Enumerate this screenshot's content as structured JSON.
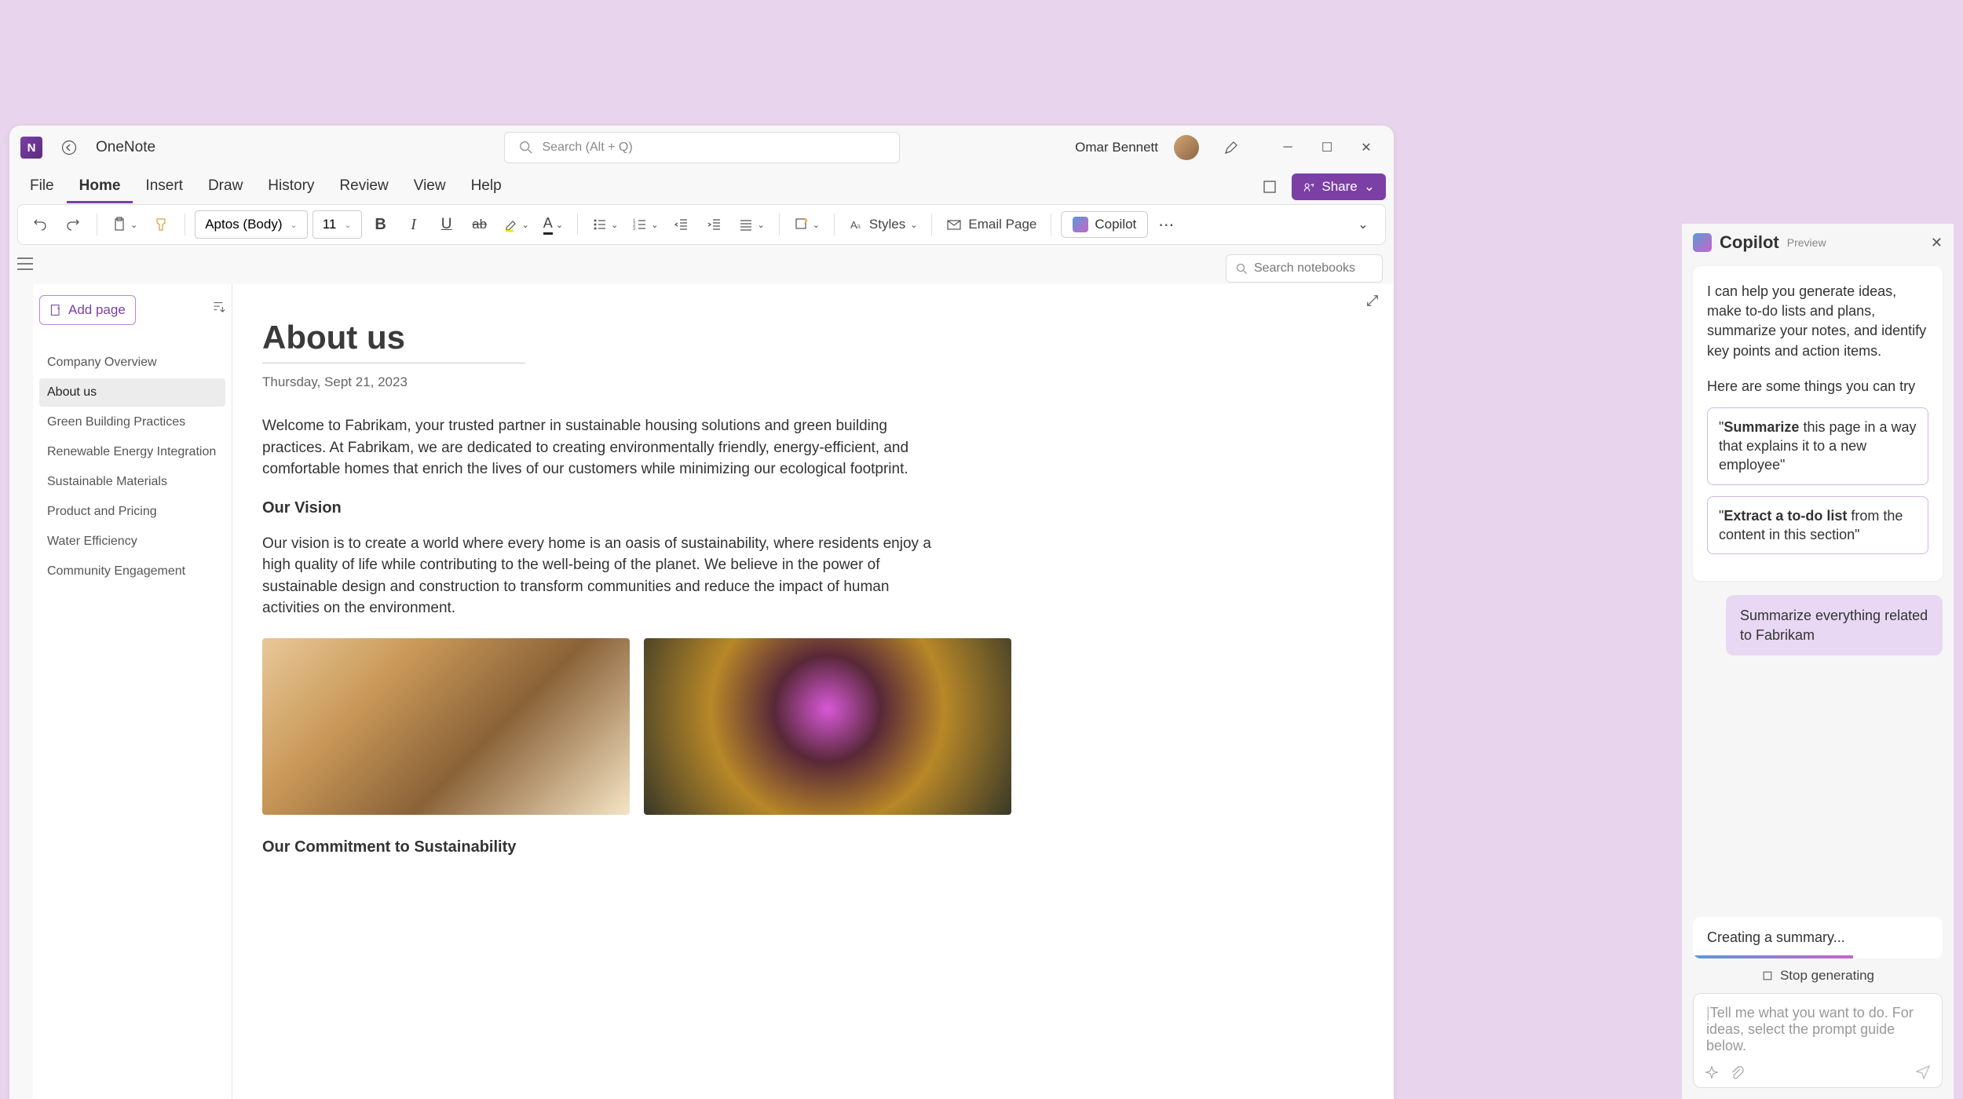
{
  "titlebar": {
    "app_name": "OneNote",
    "search_placeholder": "Search (Alt + Q)",
    "user_name": "Omar Bennett"
  },
  "menu": {
    "items": [
      "File",
      "Home",
      "Insert",
      "Draw",
      "History",
      "Review",
      "View",
      "Help"
    ],
    "active": "Home",
    "share": "Share"
  },
  "ribbon": {
    "font": "Aptos (Body)",
    "size": "11",
    "styles": "Styles",
    "email": "Email Page",
    "copilot": "Copilot"
  },
  "subbar": {
    "search_notebooks": "Search notebooks"
  },
  "sidebar": {
    "add_page": "Add page",
    "pages": [
      "Company Overview",
      "About us",
      "Green Building Practices",
      "Renewable Energy Integration",
      "Sustainable Materials",
      "Product and Pricing",
      "Water Efficiency",
      "Community Engagement"
    ],
    "active_index": 1
  },
  "note": {
    "title": "About us",
    "date": "Thursday, Sept 21, 2023",
    "p1": "Welcome to Fabrikam, your trusted partner in sustainable housing solutions and green building practices. At Fabrikam, we are dedicated to creating environmentally friendly, energy-efficient, and comfortable homes that enrich the lives of our customers while minimizing our ecological footprint.",
    "h1": "Our Vision",
    "p2": "Our vision is to create a world where every home is an oasis of sustainability, where residents enjoy a high quality of life while contributing to the well-being of the planet. We believe in the power of sustainable design and construction to transform communities and reduce the impact of human activities on the environment.",
    "h2": "Our Commitment to Sustainability"
  },
  "copilot": {
    "title": "Copilot",
    "preview": "Preview",
    "intro": "I can help you generate ideas, make to-do lists and plans, summarize your notes, and identify key points and action items.",
    "sub": "Here are some things you can try",
    "sugg1_bold": "Summarize",
    "sugg1_rest": " this page in a way that explains it to a new employee\"",
    "sugg2_bold": "Extract a to-do list",
    "sugg2_rest": " from the content in this section\"",
    "user_msg": "Summarize everything related to Fabrikam",
    "status": "Creating a summary...",
    "stop": "Stop generating",
    "input_placeholder": "Tell me what you want to do. For ideas, select the prompt guide below."
  }
}
